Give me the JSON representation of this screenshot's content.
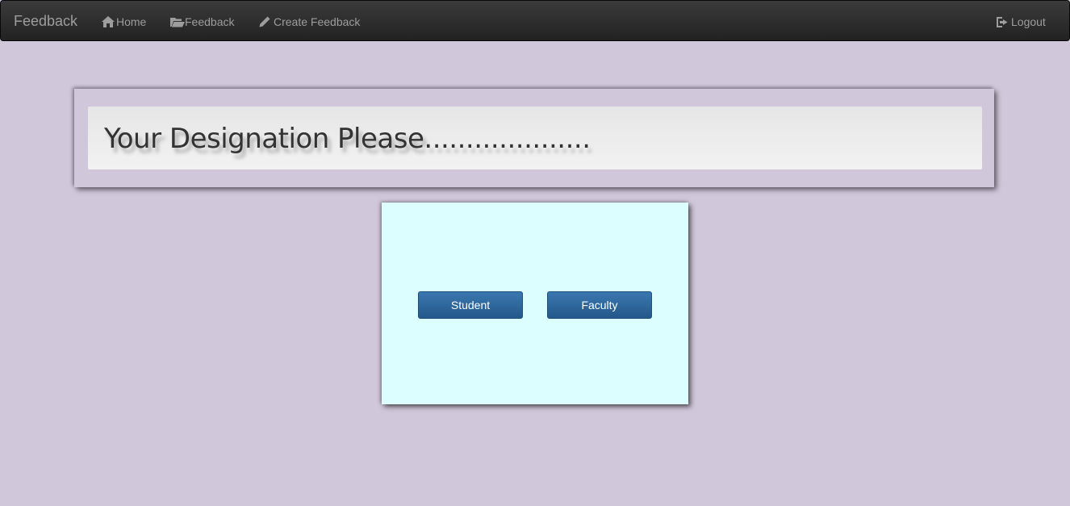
{
  "navbar": {
    "brand": "Feedback",
    "items": [
      {
        "label": "Home",
        "icon": "home-icon"
      },
      {
        "label": "Feedback",
        "icon": "folder-open-icon"
      },
      {
        "label": "Create Feedback",
        "icon": "pencil-icon"
      }
    ],
    "logout": {
      "label": "Logout",
      "icon": "logout-icon"
    }
  },
  "heading": {
    "title": "Your Designation Please...................."
  },
  "choices": {
    "student_label": "Student",
    "faculty_label": "Faculty"
  },
  "colors": {
    "page_background": "#d1c7db",
    "navbar_background": "#222222",
    "nav_text": "#9d9d9d",
    "choice_box_background": "#ddfefe",
    "button_primary": "#2a6496"
  }
}
